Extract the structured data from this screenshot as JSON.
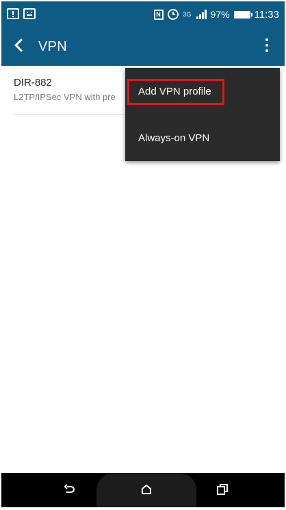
{
  "status_bar": {
    "network_type": "3G",
    "battery_percent": "97%",
    "time": "11:33",
    "icons": [
      "notification-alert-icon",
      "notification-face-icon",
      "nfc-icon",
      "alarm-icon",
      "signal-icon",
      "battery-icon"
    ]
  },
  "app_bar": {
    "title": "VPN",
    "back_icon": "back-arrow-icon",
    "menu_icon": "overflow-menu-icon"
  },
  "vpn_list": [
    {
      "name": "DIR-882",
      "type": "L2TP/IPSec VPN with pre"
    }
  ],
  "overflow_menu": {
    "items": [
      {
        "label": "Add VPN profile",
        "highlighted": true
      },
      {
        "label": "Always-on VPN",
        "highlighted": false
      }
    ]
  },
  "nav_bar": {
    "icons": [
      "back-icon",
      "home-icon",
      "recent-apps-icon"
    ]
  },
  "colors": {
    "primary": "#0e5b86",
    "menu_bg": "#2b2b2b",
    "highlight": "#e0171b"
  }
}
